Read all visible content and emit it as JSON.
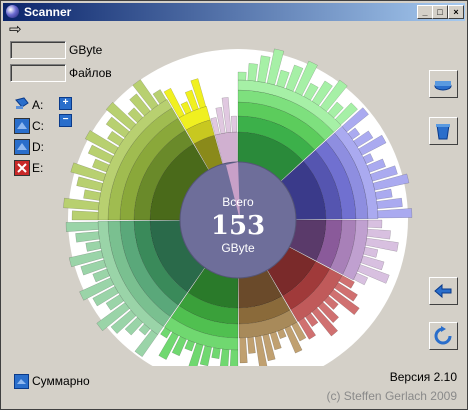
{
  "window": {
    "title": "Scanner",
    "buttons": [
      "_",
      "□",
      "×"
    ]
  },
  "menu": {
    "arrow_glyph": "⇨"
  },
  "info": {
    "size_unit": "GByte",
    "files_label": "Файлов",
    "size_value": "",
    "files_value": ""
  },
  "drives": [
    {
      "label": "A:",
      "type": "floppy-icon"
    },
    {
      "label": "C:",
      "type": "disk-icon"
    },
    {
      "label": "D:",
      "type": "disk-icon"
    },
    {
      "label": "E:",
      "type": "disk-error-icon"
    }
  ],
  "center": {
    "top": "Всего",
    "value": "153",
    "unit": "GByte"
  },
  "side_buttons": [
    "scan-icon",
    "trash-icon",
    "back-arrow-icon",
    "refresh-icon"
  ],
  "footer": {
    "summary_label": "Суммарно",
    "version": "Версия 2.10",
    "copyright": "(c) Steffen Gerlach 2009"
  },
  "colors": {
    "titlebar_start": "#0a246a",
    "titlebar_end": "#a6caf0",
    "center_disk": "#6e6e9a",
    "accent_blue": "#2a6ecb"
  }
}
